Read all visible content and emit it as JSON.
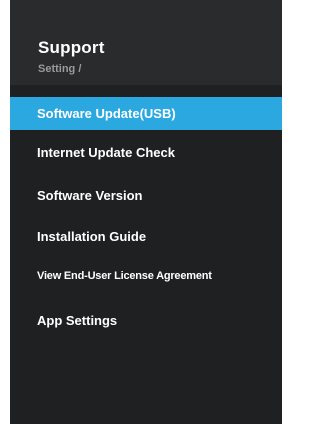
{
  "header": {
    "title": "Support",
    "breadcrumb": "Setting /"
  },
  "menu": {
    "items": [
      {
        "label": "Software Update(USB)",
        "selected": true
      },
      {
        "label": "Internet Update Check",
        "selected": false
      },
      {
        "label": "Software Version",
        "selected": false
      },
      {
        "label": "Installation Guide",
        "selected": false
      },
      {
        "label": "View End-User License Agreement",
        "selected": false
      },
      {
        "label": "App Settings",
        "selected": false
      }
    ]
  },
  "colors": {
    "panel_background": "#1f2021",
    "header_background": "#2a2b2c",
    "highlight": "#2ba8e0",
    "text": "#ffffff",
    "breadcrumb_text": "#9a9a9a"
  }
}
